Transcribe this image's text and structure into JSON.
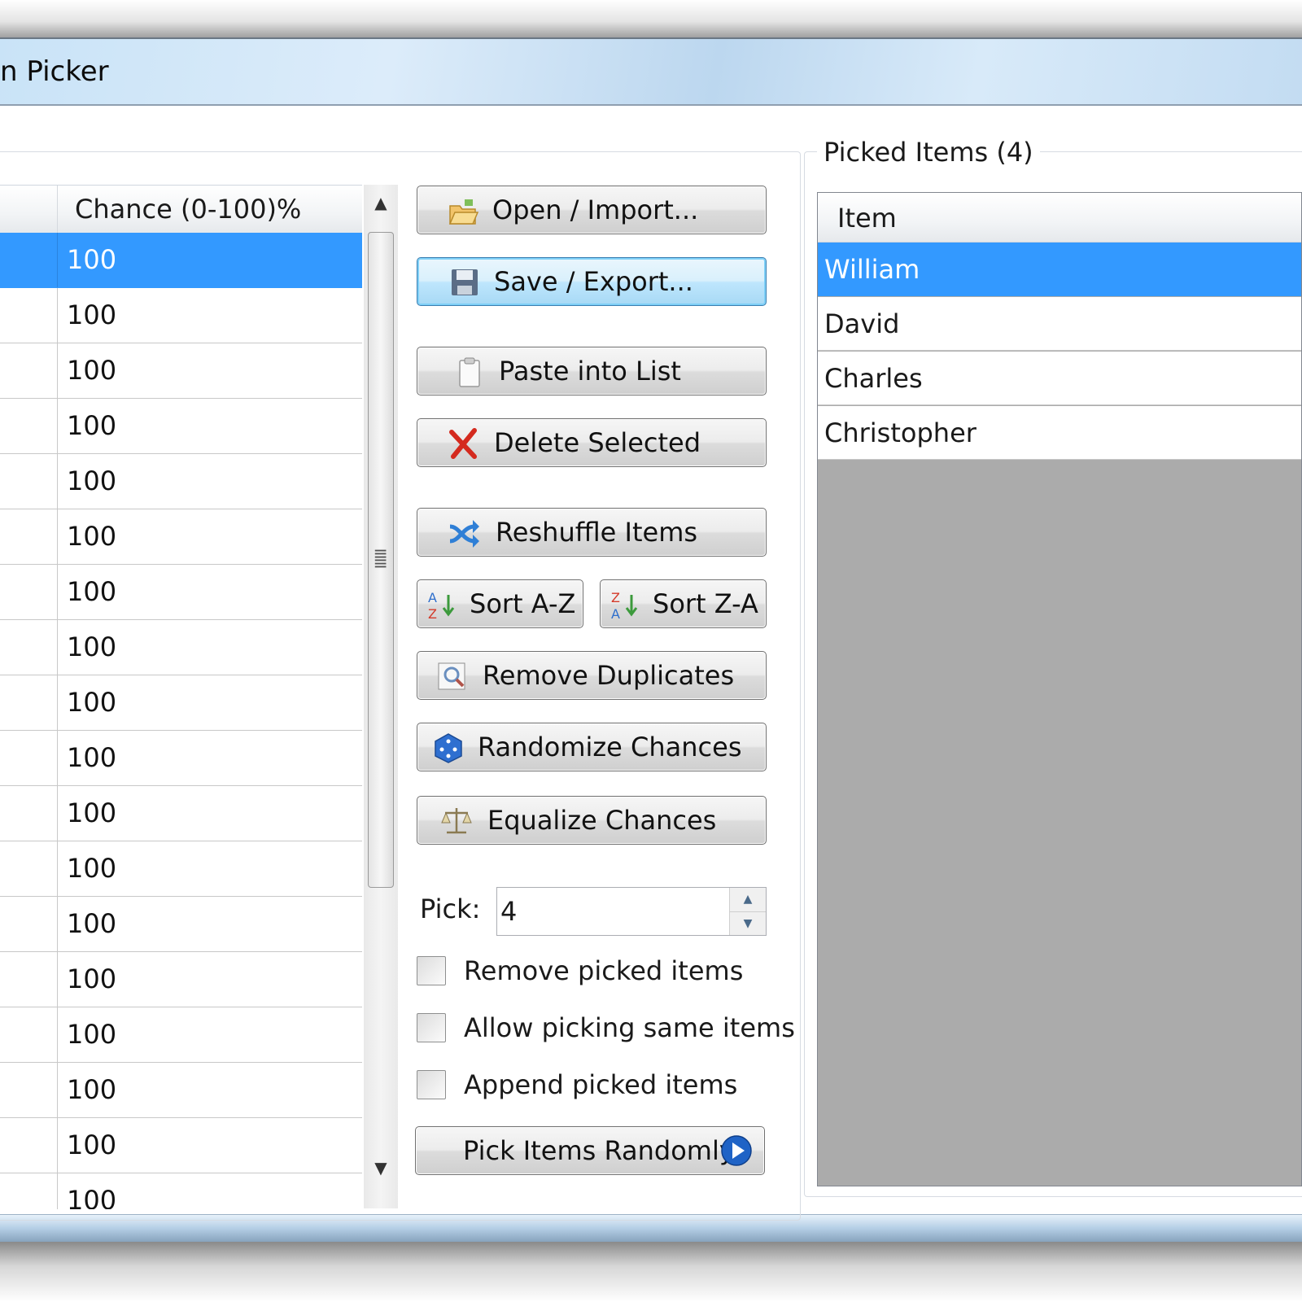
{
  "window": {
    "title": "n Picker"
  },
  "item_list": {
    "header_chance": "Chance (0-100)%",
    "rows": [
      "100",
      "100",
      "100",
      "100",
      "100",
      "100",
      "100",
      "100",
      "100",
      "100",
      "100",
      "100",
      "100",
      "100",
      "100",
      "100",
      "100",
      "100"
    ],
    "selected_index": 0
  },
  "buttons": {
    "open": "Open / Import...",
    "save": "Save / Export...",
    "paste": "Paste into List",
    "delete": "Delete Selected",
    "reshuffle": "Reshuffle Items",
    "sort_az": "Sort A-Z",
    "sort_za": "Sort Z-A",
    "remove_dup": "Remove Duplicates",
    "randomize": "Randomize Chances",
    "equalize": "Equalize Chances",
    "pick": "Pick Items Randomly"
  },
  "pick": {
    "label": "Pick:",
    "value": "4"
  },
  "options": {
    "remove_picked": "Remove picked items",
    "allow_same": "Allow picking same items",
    "append_picked": "Append picked items"
  },
  "picked_panel": {
    "title": "Picked Items (4)",
    "header": "Item",
    "items": [
      "William",
      "David",
      "Charles",
      "Christopher"
    ]
  },
  "colors": {
    "selection": "#3399ff",
    "empty_area": "#ababab"
  },
  "icons": {
    "open": "folder-open-icon",
    "save": "floppy-disk-icon",
    "paste": "clipboard-icon",
    "delete": "red-x-icon",
    "reshuffle": "shuffle-icon",
    "sort_az": "sort-az-icon",
    "sort_za": "sort-za-icon",
    "remove_dup": "magnifier-list-icon",
    "randomize": "dice-icon",
    "equalize": "scales-icon",
    "pick": "play-circle-icon"
  }
}
